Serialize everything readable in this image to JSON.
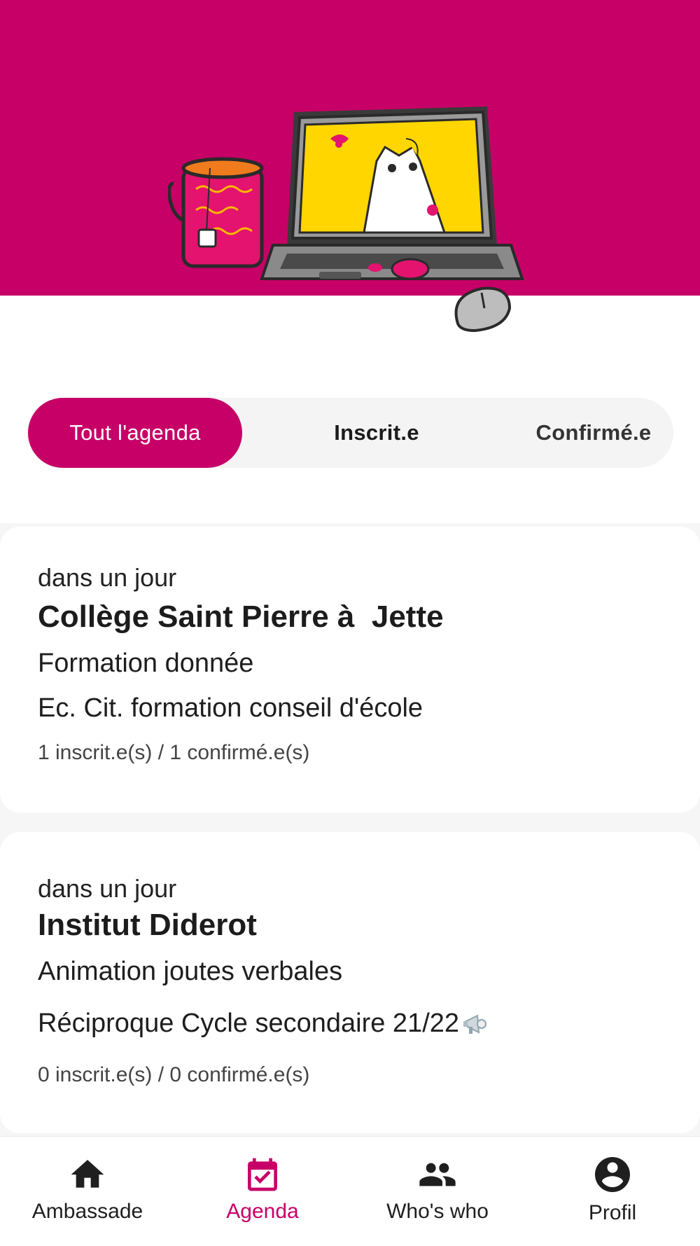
{
  "colors": {
    "brand": "#c70067",
    "screen": "#ffd600",
    "text": "#1f1f1f"
  },
  "tabs": {
    "all": "Tout l'agenda",
    "registered": "Inscrit.e",
    "confirmed": "Confirmé.e",
    "selected": "all"
  },
  "events": [
    {
      "when": "dans un jour",
      "title": "Collège Saint Pierre à  Jette",
      "kind": "Formation donnée",
      "program": "Ec. Cit. formation conseil d'école",
      "counts": "1 inscrit.e(s) / 1 confirmé.e(s)"
    },
    {
      "when": "dans un jour",
      "title": "Institut Diderot",
      "kind": "Animation joutes verbales",
      "program": "Réciproque Cycle secondaire 21/22",
      "program_icon": "megaphone-icon",
      "counts": "0 inscrit.e(s) / 0 confirmé.e(s)"
    }
  ],
  "nav": [
    {
      "label": "Ambassade",
      "icon": "home-icon"
    },
    {
      "label": "Agenda",
      "icon": "calendar-check-icon",
      "active": true
    },
    {
      "label": "Who's who",
      "icon": "people-icon"
    },
    {
      "label": "Profil",
      "icon": "account-circle-icon"
    }
  ]
}
